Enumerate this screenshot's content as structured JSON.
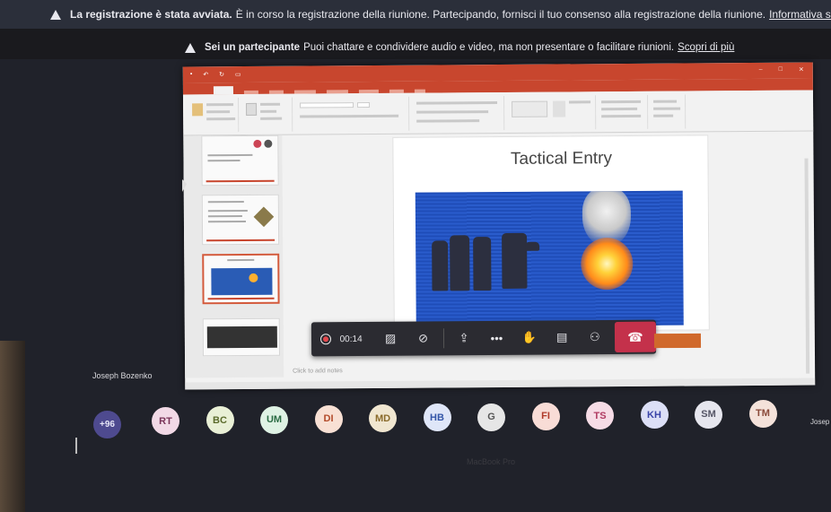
{
  "banner1": {
    "bold": "La registrazione è stata avviata.",
    "text": "È in corso la registrazione della riunione. Partecipando, fornisci il tuo consenso alla registrazione della riunione.",
    "link": "Informativa sulla privacy"
  },
  "banner2": {
    "bold": "Sei un partecipante",
    "text": "Puoi chattare e condividere audio e video, ma non presentare o facilitare riunioni.",
    "link": "Scopri di più"
  },
  "slide": {
    "title": "Tactical Entry",
    "notes_placeholder": "Click to add notes"
  },
  "meeting_bar": {
    "timer": "00:14"
  },
  "presenter_name": "Joseph Bozenko",
  "presenter_name_cut": "Josep",
  "participants": {
    "more": "+96",
    "initials": [
      "RT",
      "BC",
      "UM",
      "DI",
      "MD",
      "HB",
      "G",
      "FI",
      "TS",
      "KH",
      "SM",
      "TM"
    ],
    "colors": [
      "#f2d9e6",
      "#e9f0d6",
      "#dff2e4",
      "#f8e0d4",
      "#f0e6d0",
      "#dfe6f8",
      "#e6e6e6",
      "#f8dcd6",
      "#f6dce6",
      "#dcdff6",
      "#e6e6ee",
      "#f4e2da"
    ],
    "text_colors": [
      "#7a3459",
      "#5a6a2a",
      "#2a6b43",
      "#b34b2a",
      "#8a6a2a",
      "#3456a8",
      "#555555",
      "#b03a2a",
      "#b03a62",
      "#3a44a8",
      "#555566",
      "#8a4a3a"
    ]
  },
  "footer": "MacBook Pro"
}
